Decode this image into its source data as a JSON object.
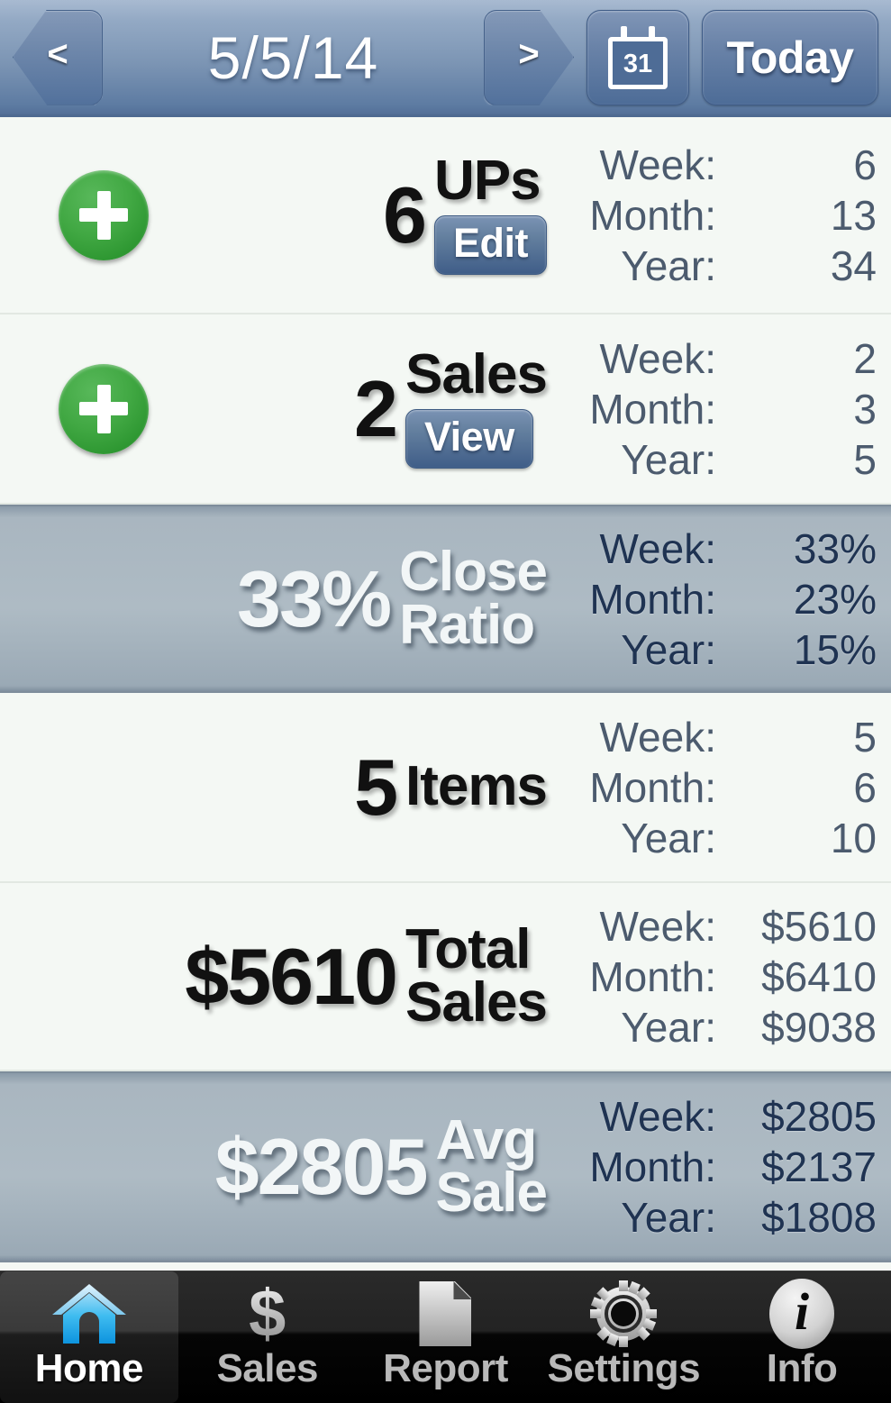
{
  "header": {
    "prev_label": "<",
    "next_label": ">",
    "date": "5/5/14",
    "calendar_icon": "calendar-31-icon",
    "calendar_day": "31",
    "today_label": "Today",
    "gradient_top": "#a8bad1",
    "gradient_bottom": "#536f97"
  },
  "rows": [
    {
      "name": "ups",
      "add_icon": "plus-icon",
      "has_add": true,
      "value": "6",
      "label": "UPs",
      "button": "Edit",
      "style": "light",
      "stats": [
        {
          "label": "Week:",
          "value": "6"
        },
        {
          "label": "Month:",
          "value": "13"
        },
        {
          "label": "Year:",
          "value": "34"
        }
      ]
    },
    {
      "name": "sales",
      "add_icon": "plus-icon",
      "has_add": true,
      "value": "2",
      "label": "Sales",
      "button": "View",
      "style": "light",
      "stats": [
        {
          "label": "Week:",
          "value": "2"
        },
        {
          "label": "Month:",
          "value": "3"
        },
        {
          "label": "Year:",
          "value": "5"
        }
      ]
    },
    {
      "name": "close-ratio",
      "has_add": false,
      "value": "33%",
      "label": "Close\nRatio",
      "button": null,
      "style": "dark",
      "stats": [
        {
          "label": "Week:",
          "value": "33%"
        },
        {
          "label": "Month:",
          "value": "23%"
        },
        {
          "label": "Year:",
          "value": "15%"
        }
      ]
    },
    {
      "name": "items",
      "has_add": false,
      "value": "5",
      "label": "Items",
      "button": null,
      "style": "light",
      "stats": [
        {
          "label": "Week:",
          "value": "5"
        },
        {
          "label": "Month:",
          "value": "6"
        },
        {
          "label": "Year:",
          "value": "10"
        }
      ]
    },
    {
      "name": "total-sales",
      "has_add": false,
      "value": "$5610",
      "label": "Total\nSales",
      "button": null,
      "style": "light",
      "stats": [
        {
          "label": "Week:",
          "value": "$5610"
        },
        {
          "label": "Month:",
          "value": "$6410"
        },
        {
          "label": "Year:",
          "value": "$9038"
        }
      ]
    },
    {
      "name": "avg-sale",
      "has_add": false,
      "value": "$2805",
      "label": "Avg\nSale",
      "button": null,
      "style": "dark",
      "stats": [
        {
          "label": "Week:",
          "value": "$2805"
        },
        {
          "label": "Month:",
          "value": "$2137"
        },
        {
          "label": "Year:",
          "value": "$1808"
        }
      ]
    }
  ],
  "tabbar": {
    "active": "Home",
    "items": [
      {
        "label": "Home",
        "icon": "home-icon",
        "active": true
      },
      {
        "label": "Sales",
        "icon": "dollar-icon",
        "active": false
      },
      {
        "label": "Report",
        "icon": "document-icon",
        "active": false
      },
      {
        "label": "Settings",
        "icon": "gear-icon",
        "active": false
      },
      {
        "label": "Info",
        "icon": "info-icon",
        "active": false
      }
    ]
  },
  "colors": {
    "header_blue": "#6f88ab",
    "row_light": "#f4f8f4",
    "row_dark": "#aebbc4",
    "accent_green": "#41a843",
    "button_blue": "#4d6c97",
    "stat_text": "#4c5b6e",
    "tab_active_blue": "#27a8e8"
  }
}
